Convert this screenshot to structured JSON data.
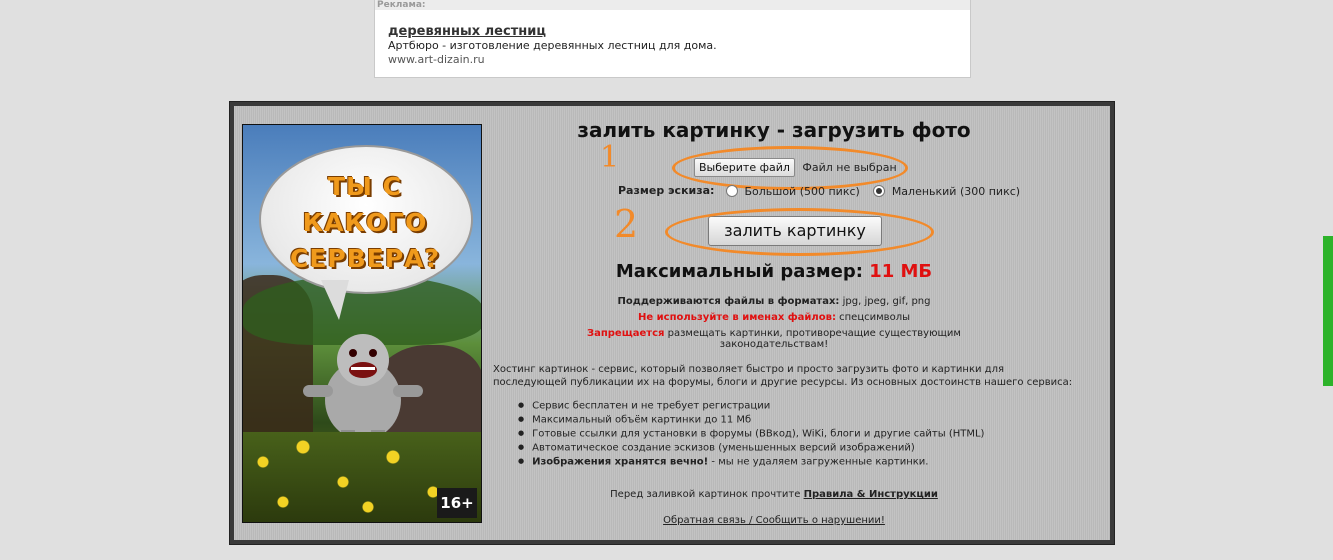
{
  "ad": {
    "header": "Реклама:",
    "title": "деревянных лестниц",
    "description": "Артбюро - изготовление деревянных лестниц для дома.",
    "url": "www.art-dizain.ru"
  },
  "banner": {
    "bubble_line1": "ТЫ С КАКОГО",
    "bubble_line2": "СЕРВЕРА?",
    "age": "16+"
  },
  "main": {
    "title": "залить картинку - загрузить фото",
    "file_button": "Выберите файл",
    "file_status": "Файл не выбран",
    "size_label": "Размер эскиза:",
    "size_big": "Большой (500 пикс)",
    "size_small": "Маленький (300 пикс)",
    "selected_size": "small",
    "upload_button": "залить картинку",
    "max_size_label": "Максимальный размер:",
    "max_size_value": "11 МБ",
    "formats_label": "Поддерживаются файлы в форматах:",
    "formats_value": "jpg, jpeg, gif, png",
    "names_label": "Не используйте в именах файлов:",
    "names_value": "спецсимволы",
    "forbid_label": "Запрещается",
    "forbid_text": "размещать картинки, противоречащие существующим законодательствам!",
    "description": "Хостинг картинок - сервис, который позволяет быстро и просто загрузить фото и картинки для последующей публикации их на форумы, блоги и другие ресурсы. Из основных достоинств нашего сервиса:",
    "features": [
      "Сервис бесплатен и не требует регистрации",
      "Максимальный объём картинки до 11 Мб",
      "Готовые ссылки для установки в форумы (ВВкод), WiKi, блоги и другие сайты (HTML)",
      "Автоматическое создание эскизов (уменьшенных версий изображений)"
    ],
    "feature_last_bold": "Изображения хранятся вечно!",
    "feature_last_rest": " - мы не удаляем загруженные картинки.",
    "rules_text": "Перед заливкой картинок прочтите",
    "rules_link": "Правила & Инструкции",
    "feedback_link": "Обратная связь / Сообщить о нарушении!"
  },
  "annotations": {
    "num1": "1",
    "num2": "2",
    "color": "#f28a2a"
  }
}
